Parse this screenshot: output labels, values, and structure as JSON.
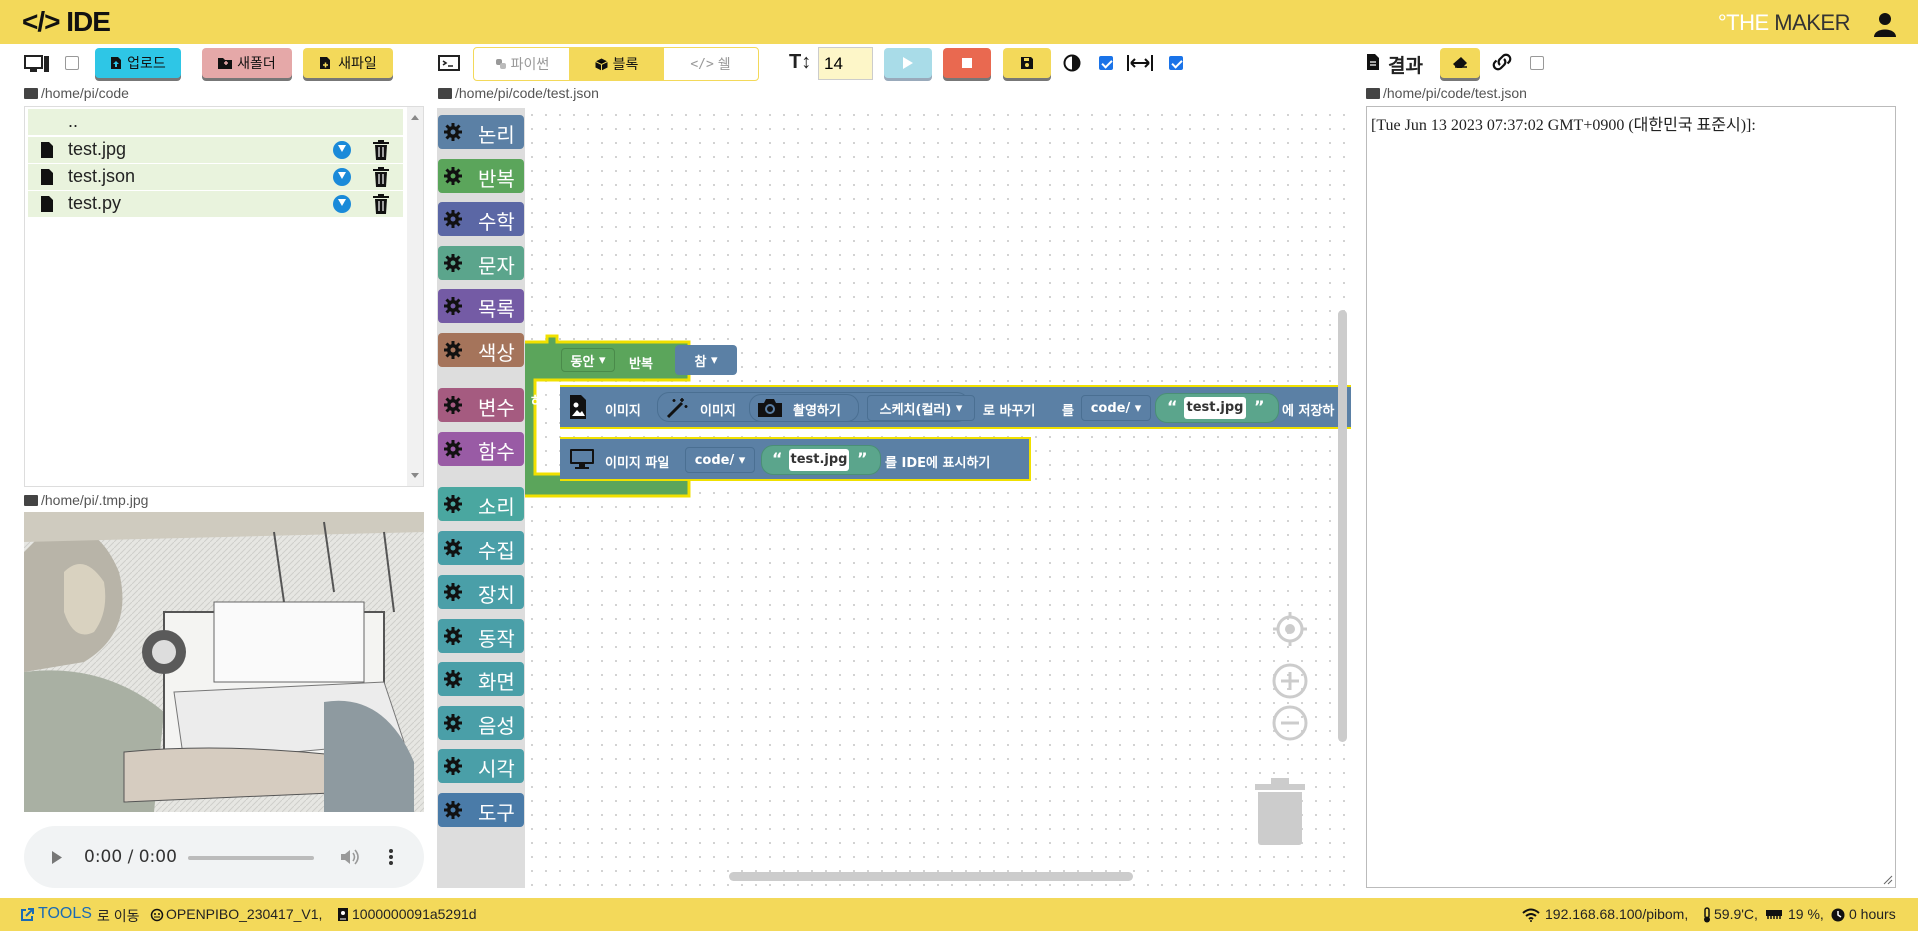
{
  "app": {
    "logo": "</> IDE",
    "brand_a": "°THE ",
    "brand_b": "MAKER"
  },
  "toolbar": {
    "upload": "업로드",
    "new_folder": "새폴더",
    "new_file": "새파일",
    "tab_python": "파이썬",
    "tab_block": "블록",
    "tab_shell": "쉘",
    "font_size": "14",
    "result_label": "결과"
  },
  "paths": {
    "files": "/home/pi/code",
    "editor": "/home/pi/code/test.json",
    "preview": "/home/pi/.tmp.jpg",
    "result": "/home/pi/code/test.json"
  },
  "files": [
    {
      "name": ".."
    },
    {
      "name": "test.jpg"
    },
    {
      "name": "test.json"
    },
    {
      "name": "test.py"
    }
  ],
  "audio": {
    "time": "0:00 / 0:00"
  },
  "categories": [
    {
      "label": "논리",
      "color": "#5b80a5"
    },
    {
      "label": "반복",
      "color": "#5ba55b"
    },
    {
      "label": "수학",
      "color": "#5b67a5"
    },
    {
      "label": "문자",
      "color": "#5ba58c"
    },
    {
      "label": "목록",
      "color": "#745ba5"
    },
    {
      "label": "색상",
      "color": "#a5745b"
    },
    {
      "label": "변수",
      "color": "#a55b80"
    },
    {
      "label": "함수",
      "color": "#995ba5"
    },
    {
      "label": "소리",
      "color": "#4aa7a0"
    },
    {
      "label": "수집",
      "color": "#4a9fa8"
    },
    {
      "label": "장치",
      "color": "#4a9fa8"
    },
    {
      "label": "동작",
      "color": "#4a9fa8"
    },
    {
      "label": "화면",
      "color": "#4a9fa8"
    },
    {
      "label": "음성",
      "color": "#4a9fa8"
    },
    {
      "label": "시각",
      "color": "#4a9fa8"
    },
    {
      "label": "도구",
      "color": "#4a7ba8"
    }
  ],
  "blocks": {
    "while_mode": "동안",
    "while_label": "반복",
    "while_cond": "참",
    "do_label": "하기",
    "img1_a": "이미지",
    "img1_b": "이미지",
    "img1_capture": "촬영하기",
    "img1_sketch": "스케치(컬러)",
    "img1_c": "로 바꾸기",
    "img1_d": "를",
    "img1_dir": "code/",
    "img1_file": "test.jpg",
    "img1_e": "에 저장하",
    "img2_a": "이미지 파일",
    "img2_dir": "code/",
    "img2_file": "test.jpg",
    "img2_b": "를 IDE에 표시하기"
  },
  "result": {
    "text": "[Tue Jun 13 2023 07:37:02 GMT+0900 (대한민국 표준시)]:"
  },
  "status": {
    "tools": "TOOLS",
    "move": "로 이동",
    "device": "OPENPIBO_230417_V1,",
    "serial": "1000000091a5291d",
    "network": "192.168.68.100/pibom,",
    "temp": "59.9'C,",
    "mem": "19 %,",
    "uptime": "0 hours"
  }
}
